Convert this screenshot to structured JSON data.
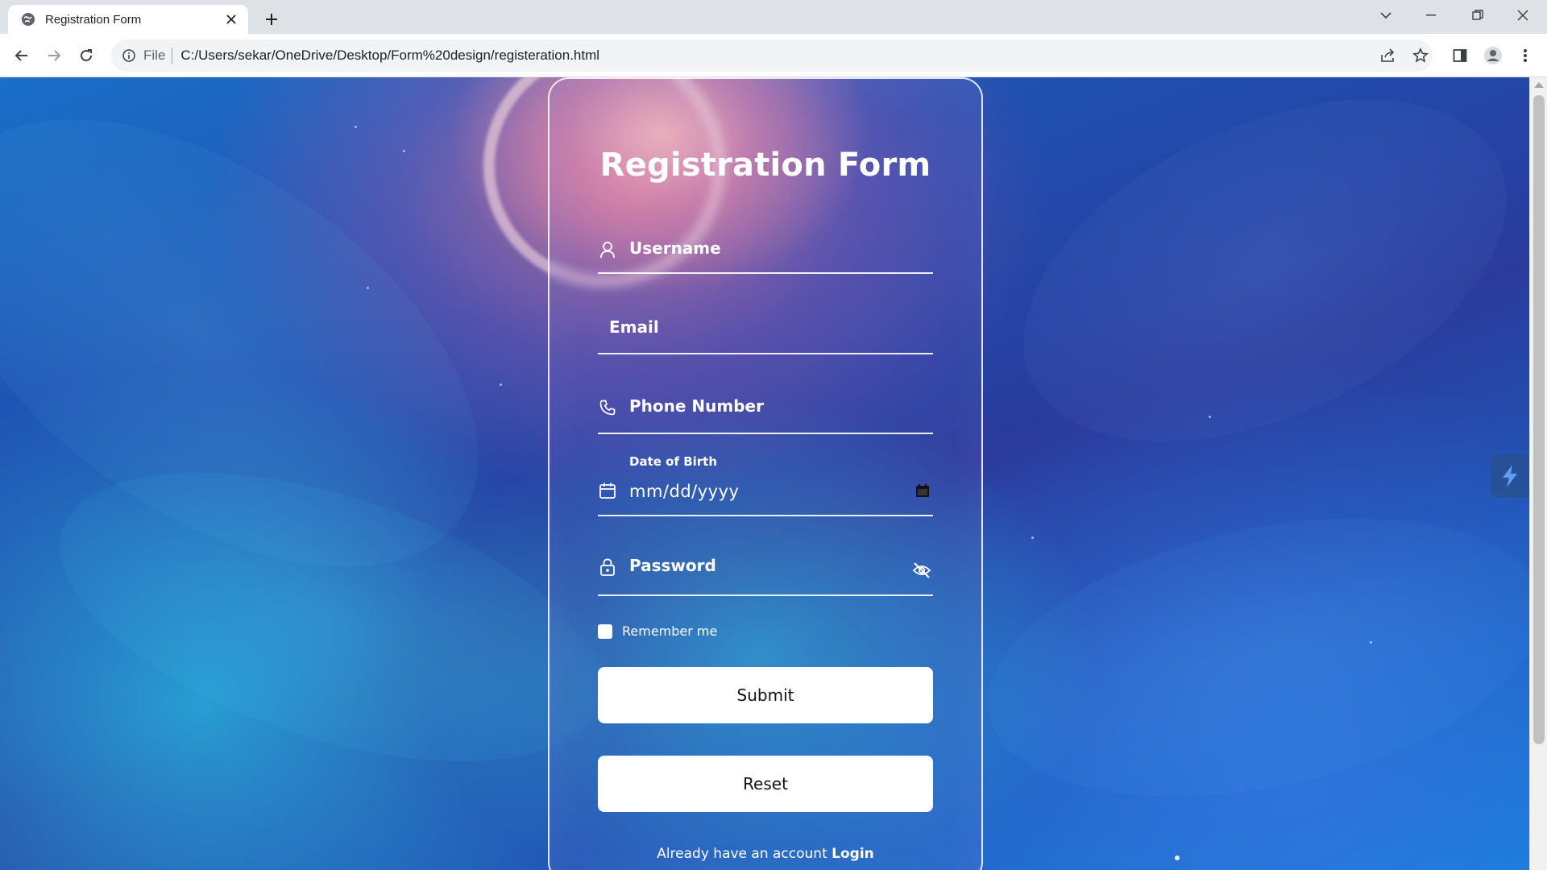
{
  "browser": {
    "tab_title": "Registration Form",
    "address_scheme": "File",
    "address_url": "C:/Users/sekar/OneDrive/Desktop/Form%20design/registeration.html"
  },
  "form": {
    "title": "Registration Form",
    "username_placeholder": "Username",
    "email_placeholder": "Email",
    "phone_placeholder": "Phone Number",
    "dob_label": "Date of Birth",
    "dob_placeholder": "mm/dd/yyyy",
    "password_placeholder": "Password",
    "remember_label": "Remember me",
    "remember_checked": false,
    "submit_label": "Submit",
    "reset_label": "Reset",
    "footer_text": "Already have an account",
    "login_label": "Login"
  },
  "icons": {
    "username": "user-icon",
    "phone": "phone-icon",
    "dob": "calendar-icon",
    "password": "lock-icon",
    "password_toggle": "eye-off-icon"
  }
}
